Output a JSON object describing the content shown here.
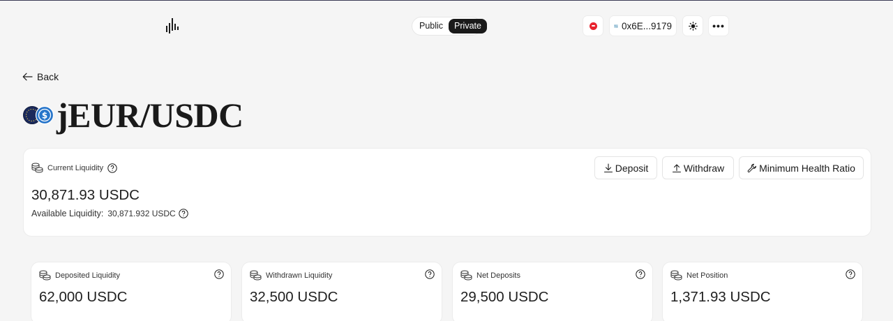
{
  "header": {
    "toggle": {
      "public_label": "Public",
      "private_label": "Private",
      "selected": "Private"
    },
    "network_icon": "optimism-network-icon",
    "wallet": {
      "address": "0x6E...9179",
      "icon": "wallet-avatar-icon"
    },
    "theme_icon": "sun-icon",
    "more_label": "•••"
  },
  "nav": {
    "back_label": "Back"
  },
  "pool": {
    "title": "jEUR/USDC",
    "icons": [
      "jeur-token-icon",
      "usdc-token-icon"
    ]
  },
  "liquidity": {
    "label": "Current Liquidity",
    "value": "30,871.93 USDC",
    "available_label": "Available Liquidity:",
    "available_value": "30,871.932 USDC",
    "actions": {
      "deposit": "Deposit",
      "withdraw": "Withdraw",
      "min_health": "Minimum Health Ratio"
    }
  },
  "stats": [
    {
      "label": "Deposited Liquidity",
      "value": "62,000 USDC"
    },
    {
      "label": "Withdrawn Liquidity",
      "value": "32,500 USDC"
    },
    {
      "label": "Net Deposits",
      "value": "29,500 USDC"
    },
    {
      "label": "Net Position",
      "value": "1,371.93 USDC"
    }
  ],
  "colors": {
    "background": "#f5f5f5",
    "accent_dark": "#1a1a1a",
    "network_red": "#e8232e",
    "usdc_blue": "#2775ca",
    "jeur_navy": "#1b2a5c"
  }
}
